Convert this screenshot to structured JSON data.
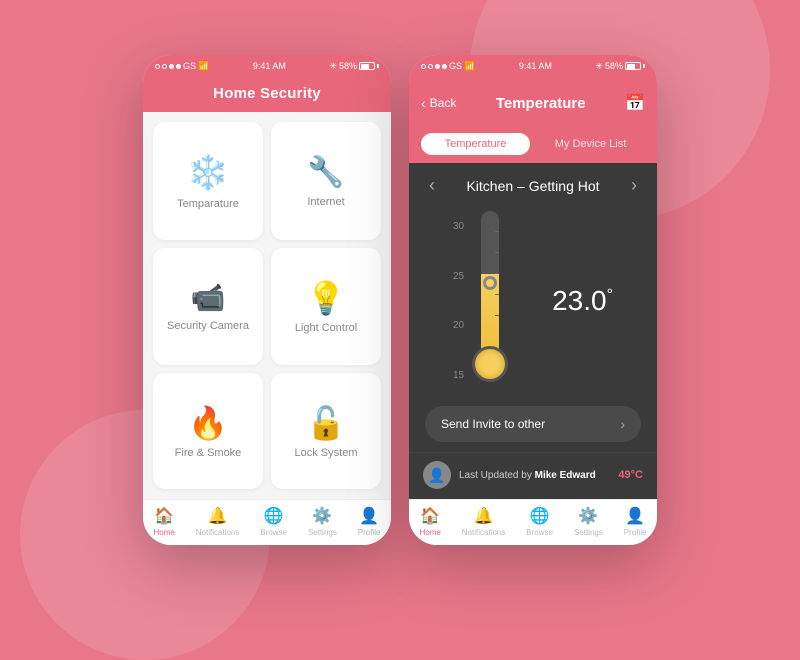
{
  "phone1": {
    "status": {
      "signal": "GS",
      "time": "9:41 AM",
      "battery": "58%"
    },
    "header": {
      "title": "Home Security"
    },
    "grid": [
      {
        "id": "temperature",
        "label": "Temparature",
        "icon": "❄️"
      },
      {
        "id": "internet",
        "label": "Internet",
        "icon": "🔧"
      },
      {
        "id": "security-camera",
        "label": "Security Camera",
        "icon": "📷"
      },
      {
        "id": "light-control",
        "label": "Light Control",
        "icon": "💡"
      },
      {
        "id": "fire-smoke",
        "label": "Fire & Smoke",
        "icon": "🔥"
      },
      {
        "id": "lock-system",
        "label": "Lock System",
        "icon": "🔓"
      }
    ],
    "nav": [
      {
        "id": "home",
        "label": "Home",
        "icon": "🏠",
        "active": true
      },
      {
        "id": "notifications",
        "label": "Notifications",
        "icon": "🔔",
        "active": false
      },
      {
        "id": "browse",
        "label": "Browse",
        "icon": "🌐",
        "active": false
      },
      {
        "id": "settings",
        "label": "Settings",
        "icon": "⚙️",
        "active": false
      },
      {
        "id": "profile",
        "label": "Profile",
        "icon": "👤",
        "active": false
      }
    ]
  },
  "phone2": {
    "status": {
      "signal": "GS",
      "time": "9:41 AM",
      "battery": "58%"
    },
    "header": {
      "back_label": "Back",
      "title": "Temperature"
    },
    "tabs": [
      {
        "id": "temperature",
        "label": "Temperature",
        "active": true
      },
      {
        "id": "my-device-list",
        "label": "My Device List",
        "active": false
      }
    ],
    "kitchen": {
      "title": "Kitchen – Getting Hot"
    },
    "thermometer": {
      "scale": [
        "30",
        "25",
        "20",
        "15"
      ],
      "value": "23.0",
      "unit": "°"
    },
    "invite": {
      "label": "Send Invite to other"
    },
    "last_updated": {
      "text": "Last Updated by",
      "user": "Mike Edward",
      "temp": "49°C"
    },
    "nav": [
      {
        "id": "home",
        "label": "Home",
        "icon": "🏠",
        "active": true
      },
      {
        "id": "notifications",
        "label": "Notifications",
        "icon": "🔔",
        "active": false
      },
      {
        "id": "browse",
        "label": "Browse",
        "icon": "🌐",
        "active": false
      },
      {
        "id": "settings",
        "label": "Settings",
        "icon": "⚙️",
        "active": false
      },
      {
        "id": "profile",
        "label": "Profile",
        "icon": "👤",
        "active": false
      }
    ]
  }
}
